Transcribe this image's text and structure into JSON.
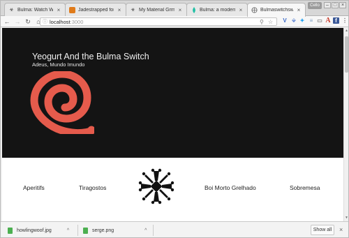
{
  "browser": {
    "tabs": [
      {
        "title": "Bulma: Watch With",
        "icon": "hazard-icon"
      },
      {
        "title": "Jadestrapped for Co",
        "icon": "orange-square-icon"
      },
      {
        "title": "My Material Grml",
        "icon": "hazard-icon"
      },
      {
        "title": "Bulma: a modern CS",
        "icon": "teal-drop-icon"
      },
      {
        "title": "Bulmaswitchswatch",
        "icon": "globe-icon"
      }
    ],
    "profile_label": "Cello",
    "url_host": "localhost",
    "url_port": ":3000",
    "extensions": [
      "vee-icon",
      "dropbox-icon",
      "twitter-icon",
      "stack-icon",
      "reader-icon",
      "a-icon",
      "facebook-icon",
      "menu-icon"
    ]
  },
  "page": {
    "hero_title": "Yeogurt And the Bulma Switch",
    "hero_subtitle": "Adeus, Mundo Imundo",
    "menu": [
      "Aperitifs",
      "Tiragostos",
      "Boi Morto Grelhado",
      "Sobremesa"
    ],
    "accent": "#e55b4c"
  },
  "downloads": {
    "files": [
      "howlingwoof.jpg",
      "serge.png"
    ],
    "show_all": "Show all"
  }
}
